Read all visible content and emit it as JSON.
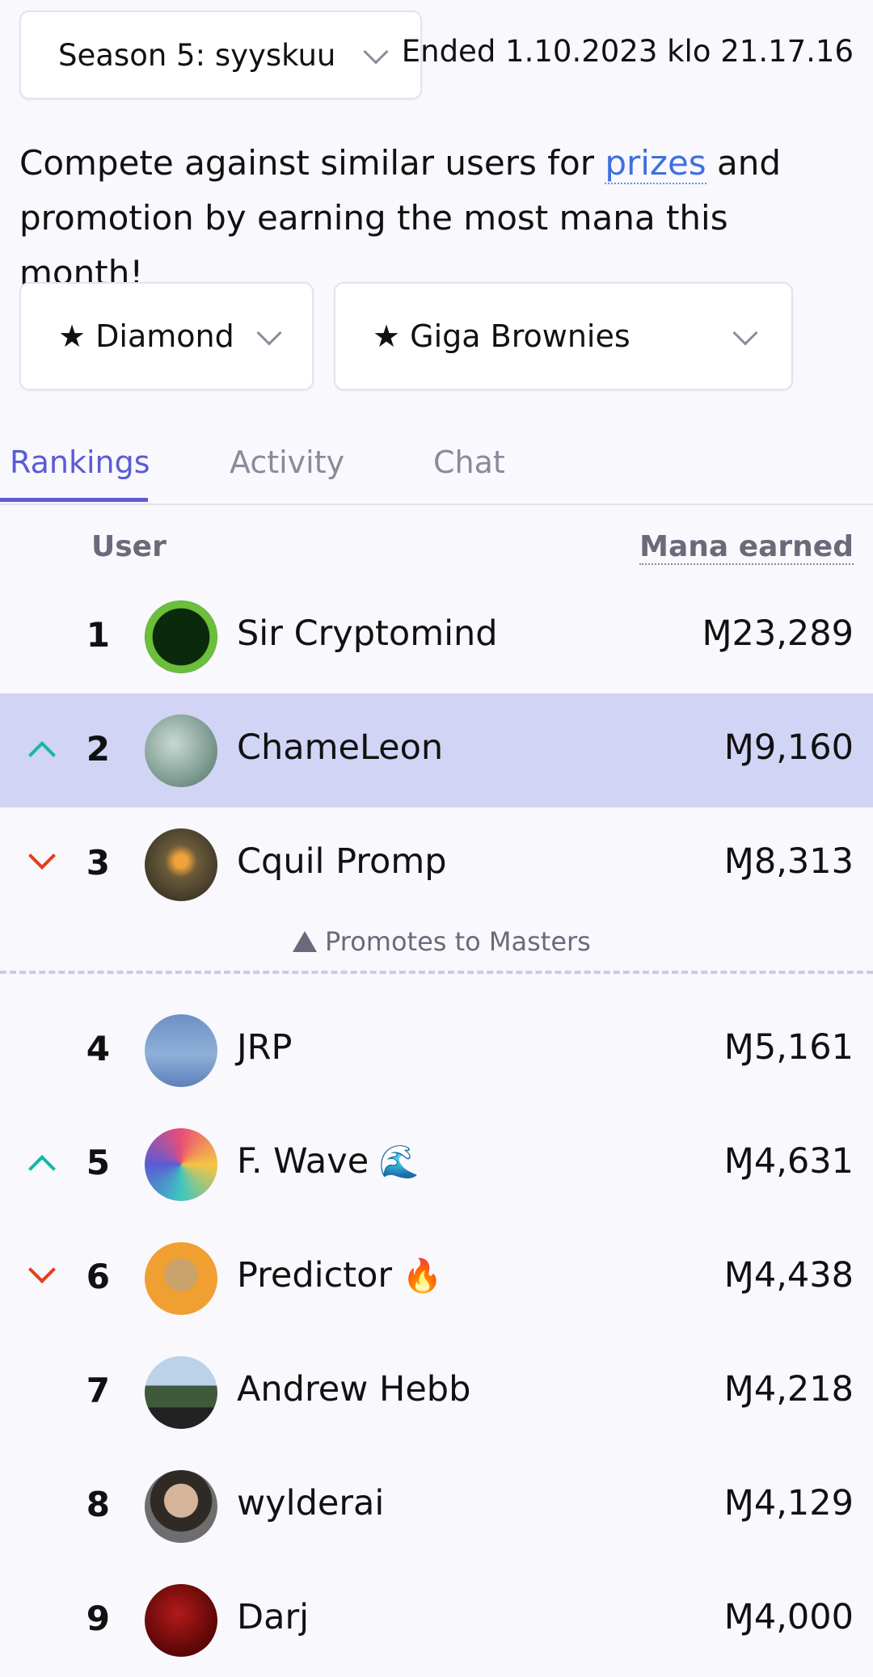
{
  "season": {
    "selected": "Season 5: syyskuu",
    "ended_text": "Ended 1.10.2023 klo 21.17.16"
  },
  "intro": {
    "before": "Compete against similar users for ",
    "link": "prizes",
    "after": " and promotion by earning the most mana this month!"
  },
  "filters": {
    "division": "★ Diamond",
    "cohort": "★ Giga Brownies"
  },
  "tabs": {
    "rankings": "Rankings",
    "activity": "Activity",
    "chat": "Chat",
    "active": "Rankings"
  },
  "table": {
    "col_user": "User",
    "col_mana": "Mana earned",
    "promotion_text": "Promotes to Masters",
    "rows": [
      {
        "rank": "1",
        "name": "Sir Cryptomind",
        "mana": "Ɱ23,289",
        "trend": "none",
        "highlight": false
      },
      {
        "rank": "2",
        "name": "ChameLeon",
        "mana": "Ɱ9,160",
        "trend": "up",
        "highlight": true
      },
      {
        "rank": "3",
        "name": "Cquil Promp",
        "mana": "Ɱ8,313",
        "trend": "down",
        "highlight": false
      },
      {
        "rank": "4",
        "name": "JRP",
        "mana": "Ɱ5,161",
        "trend": "none",
        "highlight": false
      },
      {
        "rank": "5",
        "name": "F. Wave",
        "emoji": "🌊",
        "mana": "Ɱ4,631",
        "trend": "up",
        "highlight": false
      },
      {
        "rank": "6",
        "name": "Predictor",
        "emoji": "🔥",
        "mana": "Ɱ4,438",
        "trend": "down",
        "highlight": false
      },
      {
        "rank": "7",
        "name": "Andrew Hebb",
        "mana": "Ɱ4,218",
        "trend": "none",
        "highlight": false
      },
      {
        "rank": "8",
        "name": "wylderai",
        "mana": "Ɱ4,129",
        "trend": "none",
        "highlight": false
      },
      {
        "rank": "9",
        "name": "Darj",
        "mana": "Ɱ4,000",
        "trend": "none",
        "highlight": false
      }
    ]
  },
  "colors": {
    "accent": "#5b5bd6",
    "link": "#3f6fe0",
    "trend_up": "#14b8a6",
    "trend_down": "#e53e1d",
    "highlight_row": "#d1d4f4"
  }
}
